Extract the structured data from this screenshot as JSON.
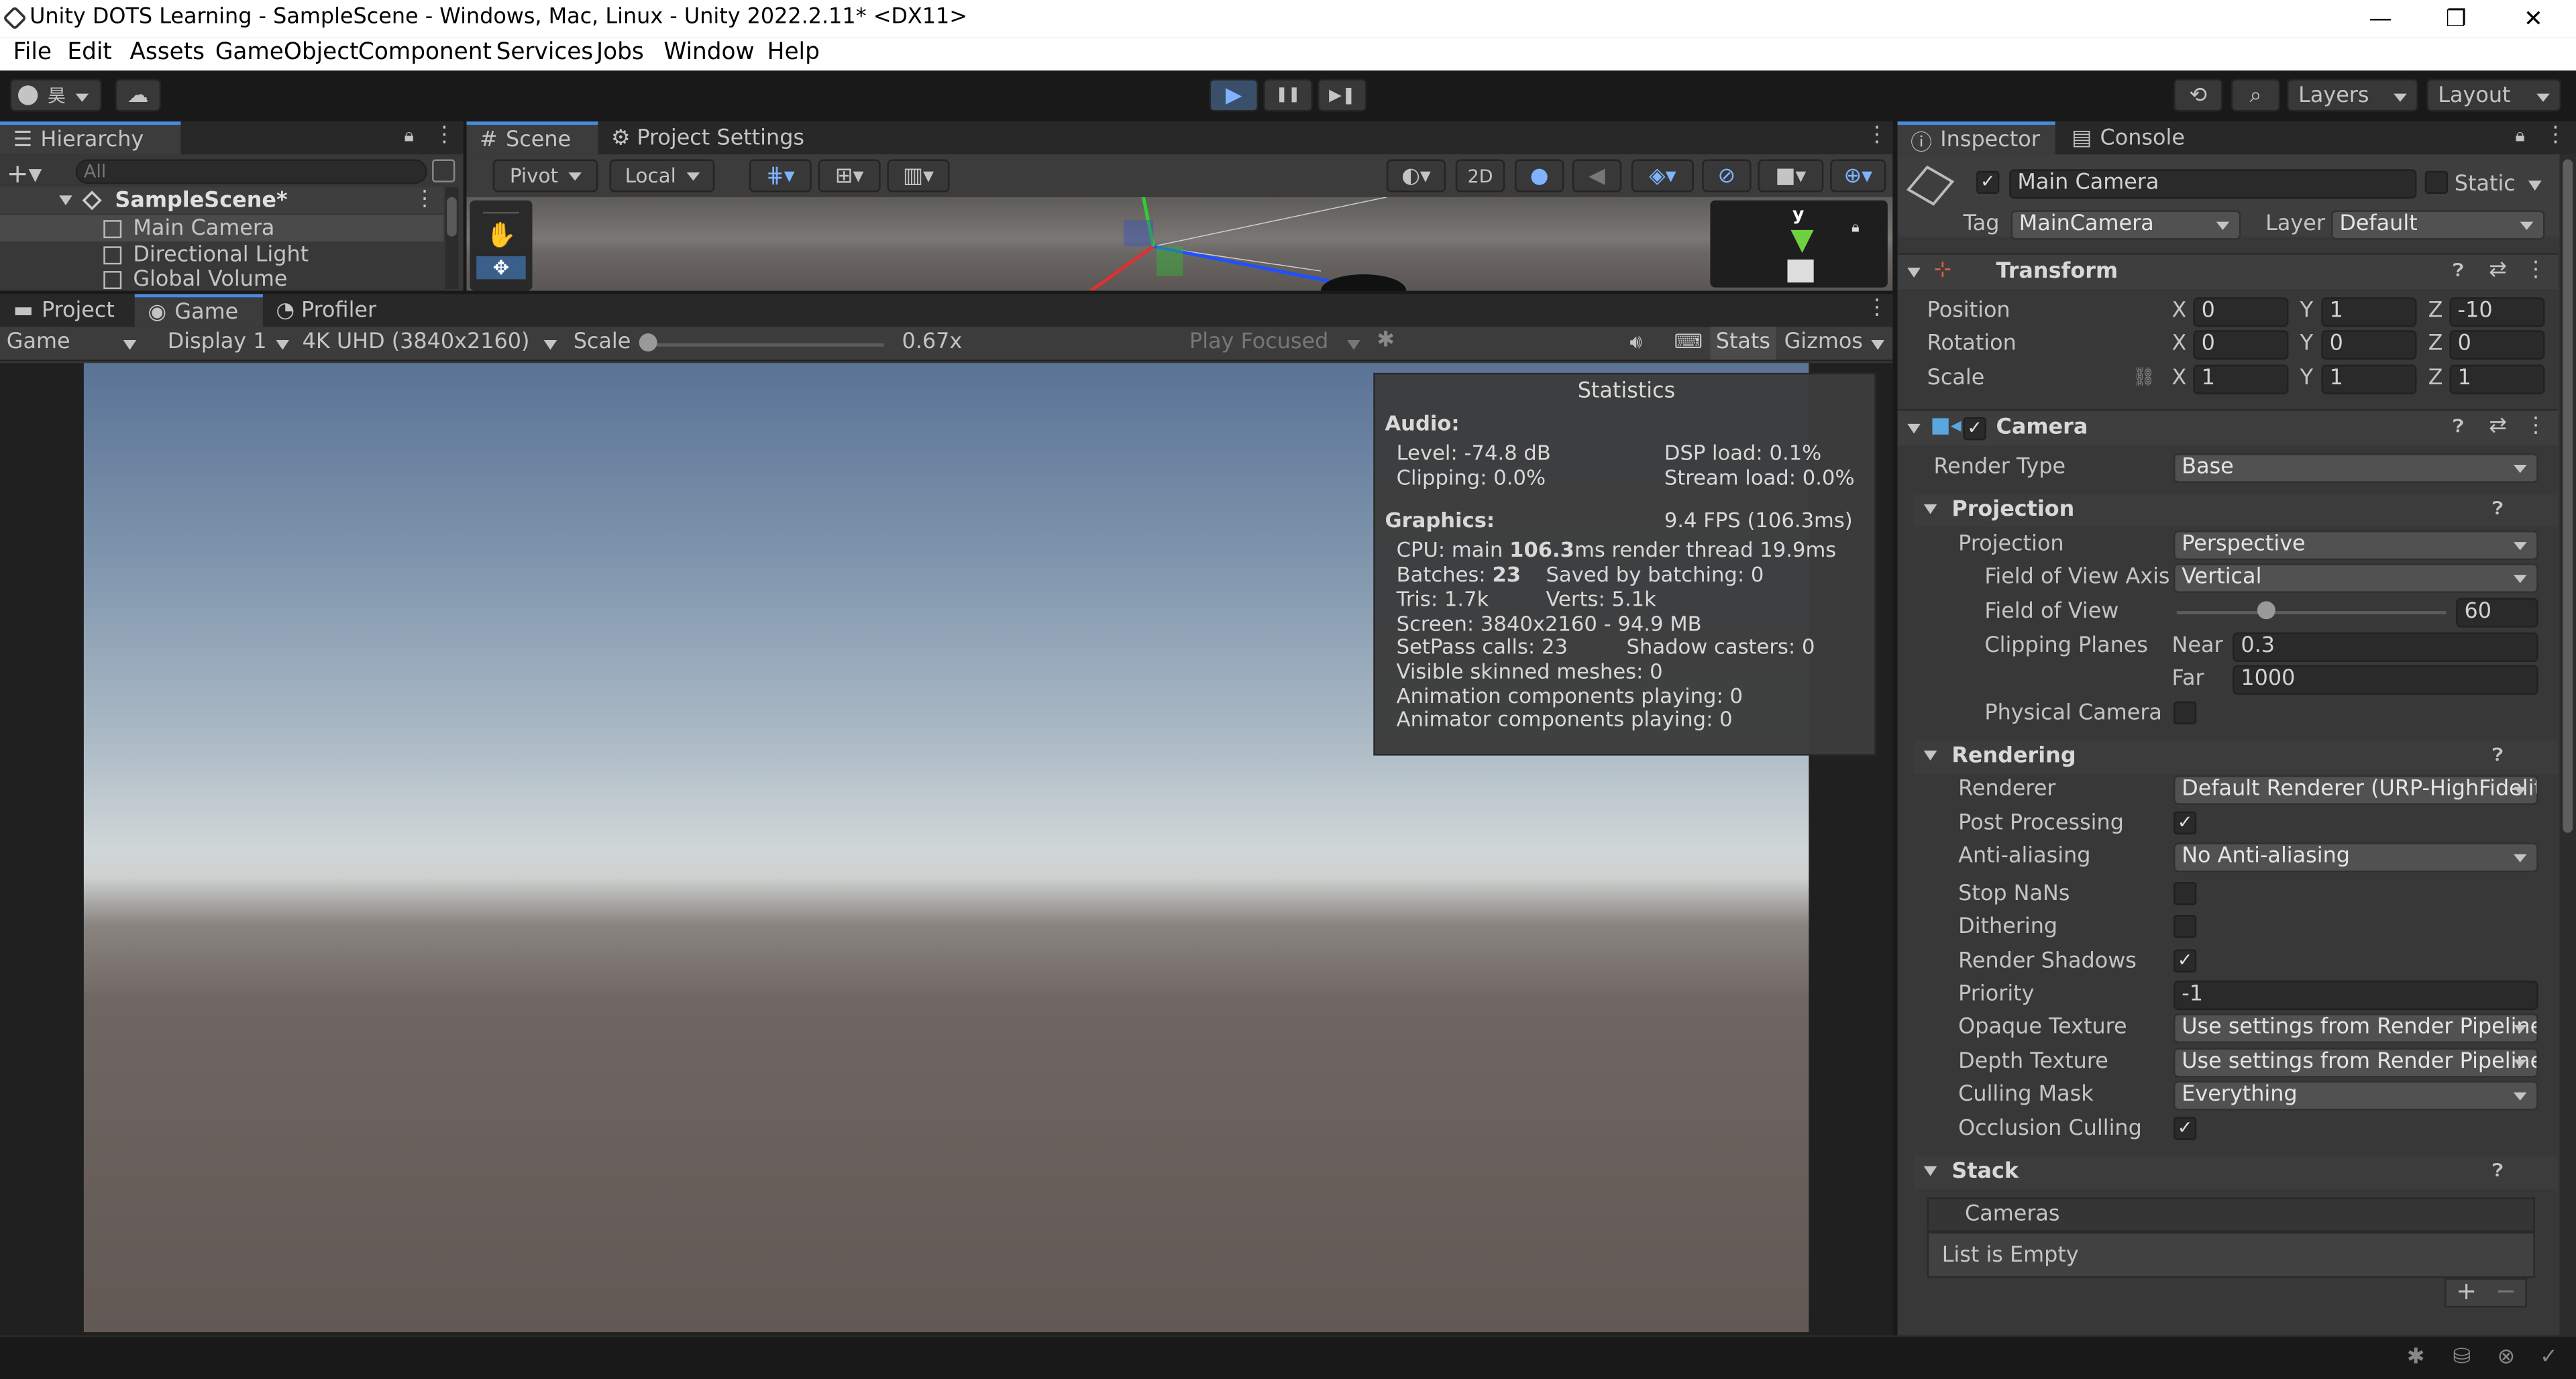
{
  "window": {
    "title": "Unity DOTS Learning - SampleScene - Windows, Mac, Linux - Unity 2022.2.11* <DX11>",
    "minimize": "—",
    "restore": "❐",
    "close": "✕"
  },
  "menu": [
    "File",
    "Edit",
    "Assets",
    "GameObject",
    "Component",
    "Services",
    "Jobs",
    "Window",
    "Help"
  ],
  "toolbar": {
    "account": "昊",
    "play": "▶",
    "pause": "❚❚",
    "step": "▶❚",
    "layers": "Layers",
    "layout": "Layout"
  },
  "hierarchy": {
    "tab": "Hierarchy",
    "search_placeholder": "All",
    "scene": "SampleScene*",
    "items": [
      "Main Camera",
      "Directional Light",
      "Global Volume"
    ]
  },
  "scene_tabs": {
    "scene": "Scene",
    "project_settings": "Project Settings"
  },
  "scene_toolbar": {
    "pivot": "Pivot",
    "local": "Local",
    "mode2d": "2D",
    "gizmo_axis": "y"
  },
  "bottom_tabs": {
    "project": "Project",
    "game": "Game",
    "profiler": "Profiler"
  },
  "game_toolbar": {
    "view": "Game",
    "display": "Display 1",
    "resolution": "4K UHD (3840x2160)",
    "scale_label": "Scale",
    "scale_value": "0.67x",
    "scale_fraction": 0.0,
    "play_focused": "Play Focused",
    "stats": "Stats",
    "gizmos": "Gizmos"
  },
  "stats": {
    "title": "Statistics",
    "audio_header": "Audio:",
    "level": "Level: -74.8 dB",
    "dsp": "DSP load: 0.1%",
    "clipping": "Clipping: 0.0%",
    "stream": "Stream load: 0.0%",
    "graphics_header": "Graphics:",
    "fps": "9.4 FPS (106.3ms)",
    "cpu_prefix": "CPU: main ",
    "cpu_bold": "106.3",
    "cpu_suffix": "ms  render thread 19.9ms",
    "batches_prefix": "Batches: ",
    "batches_bold": "23",
    "saved": "Saved by batching: 0",
    "tris": "Tris: 1.7k",
    "verts": "Verts: 5.1k",
    "screen": "Screen: 3840x2160 - 94.9 MB",
    "setpass": "SetPass calls: 23",
    "shadow": "Shadow casters: 0",
    "skinned": "Visible skinned meshes: 0",
    "anim": "Animation components playing: 0",
    "animator": "Animator components playing: 0"
  },
  "inspector": {
    "tab": "Inspector",
    "console_tab": "Console",
    "object_name": "Main Camera",
    "static": "Static",
    "tag_label": "Tag",
    "tag": "MainCamera",
    "layer_label": "Layer",
    "layer": "Default",
    "transform": {
      "header": "Transform",
      "position": "Position",
      "rotation": "Rotation",
      "scale": "Scale",
      "pos": [
        "0",
        "1",
        "-10"
      ],
      "rot": [
        "0",
        "0",
        "0"
      ],
      "scl": [
        "1",
        "1",
        "1"
      ],
      "axes": [
        "X",
        "Y",
        "Z"
      ]
    },
    "camera": {
      "header": "Camera",
      "render_type_label": "Render Type",
      "render_type": "Base",
      "projection_section": "Projection",
      "projection_label": "Projection",
      "projection": "Perspective",
      "fov_axis_label": "Field of View Axis",
      "fov_axis": "Vertical",
      "fov_label": "Field of View",
      "fov": "60",
      "fov_fraction": 0.33,
      "clip_label": "Clipping Planes",
      "near_label": "Near",
      "near": "0.3",
      "far_label": "Far",
      "far": "1000",
      "physical_label": "Physical Camera",
      "rendering_section": "Rendering",
      "renderer_label": "Renderer",
      "renderer": "Default Renderer (URP-HighFidelit",
      "post_label": "Post Processing",
      "aa_label": "Anti-aliasing",
      "aa": "No Anti-aliasing",
      "nans_label": "Stop NaNs",
      "dither_label": "Dithering",
      "shadows_label": "Render Shadows",
      "priority_label": "Priority",
      "priority": "-1",
      "opaque_label": "Opaque Texture",
      "opaque": "Use settings from Render Pipeline A",
      "depth_label": "Depth Texture",
      "depth": "Use settings from Render Pipeline A",
      "culling_label": "Culling Mask",
      "culling": "Everything",
      "occlusion_label": "Occlusion Culling",
      "stack_section": "Stack",
      "cameras_label": "Cameras",
      "empty": "List is Empty",
      "plus": "+",
      "minus": "−"
    }
  },
  "colors": {
    "accent": "#4a8ae0",
    "panel": "#383838",
    "dark": "#191919"
  }
}
